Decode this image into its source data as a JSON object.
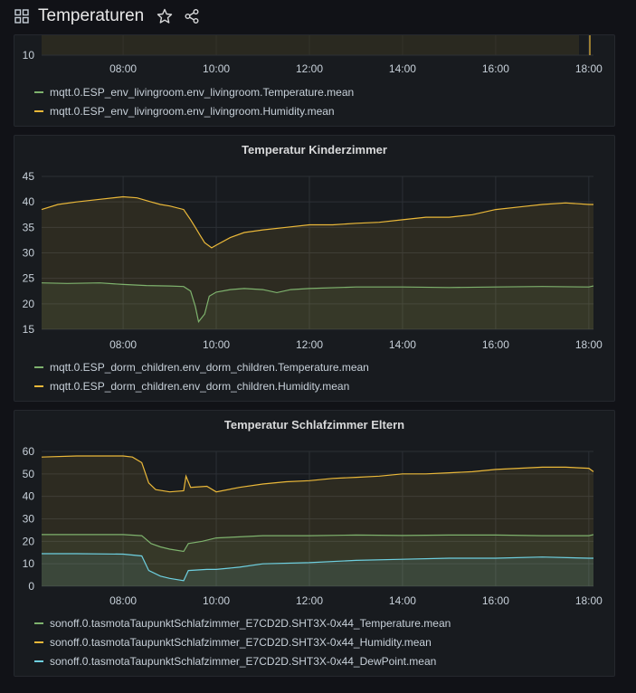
{
  "dashboard": {
    "title": "Temperaturen"
  },
  "colors": {
    "temperature": "#7eb26d",
    "humidity": "#eab839",
    "dewpoint": "#6ed0e0",
    "grid": "#2c3036"
  },
  "x_ticks": [
    "08:00",
    "10:00",
    "12:00",
    "14:00",
    "16:00",
    "18:00"
  ],
  "panels": [
    {
      "title": "",
      "legend": [
        {
          "label": "mqtt.0.ESP_env_livingroom.env_livingroom.Temperature.mean",
          "color_key": "temperature"
        },
        {
          "label": "mqtt.0.ESP_env_livingroom.env_livingroom.Humidity.mean",
          "color_key": "humidity"
        }
      ]
    },
    {
      "title": "Temperatur Kinderzimmer",
      "legend": [
        {
          "label": "mqtt.0.ESP_dorm_children.env_dorm_children.Temperature.mean",
          "color_key": "temperature"
        },
        {
          "label": "mqtt.0.ESP_dorm_children.env_dorm_children.Humidity.mean",
          "color_key": "humidity"
        }
      ]
    },
    {
      "title": "Temperatur Schlafzimmer Eltern",
      "legend": [
        {
          "label": "sonoff.0.tasmotaTaupunktSchlafzimmer_E7CD2D.SHT3X-0x44_Temperature.mean",
          "color_key": "temperature"
        },
        {
          "label": "sonoff.0.tasmotaTaupunktSchlafzimmer_E7CD2D.SHT3X-0x44_Humidity.mean",
          "color_key": "humidity"
        },
        {
          "label": "sonoff.0.tasmotaTaupunktSchlafzimmer_E7CD2D.SHT3X-0x44_DewPoint.mean",
          "color_key": "dewpoint"
        }
      ]
    }
  ],
  "chart_data": [
    {
      "type": "line",
      "title": "",
      "x_unit": "hour of day",
      "xlim": [
        6.25,
        18.1
      ],
      "x_ticks": [
        "08:00",
        "10:00",
        "12:00",
        "14:00",
        "16:00",
        "18:00"
      ],
      "y_ticks": [
        10
      ],
      "series": [
        {
          "name": "mqtt.0.ESP_env_livingroom.env_livingroom.Temperature.mean",
          "x": [],
          "values": []
        },
        {
          "name": "mqtt.0.ESP_env_livingroom.env_livingroom.Humidity.mean",
          "x": [],
          "values": []
        }
      ]
    },
    {
      "type": "line",
      "title": "Temperatur Kinderzimmer",
      "x_unit": "hour of day",
      "xlim": [
        6.25,
        18.1
      ],
      "ylim": [
        15,
        45
      ],
      "y_ticks": [
        15,
        20,
        25,
        30,
        35,
        40,
        45
      ],
      "x_ticks": [
        "08:00",
        "10:00",
        "12:00",
        "14:00",
        "16:00",
        "18:00"
      ],
      "grid": true,
      "series": [
        {
          "name": "mqtt.0.ESP_dorm_children.env_dorm_children.Temperature.mean",
          "x": [
            6.25,
            6.8,
            7.5,
            8.0,
            8.5,
            9.0,
            9.3,
            9.45,
            9.55,
            9.62,
            9.75,
            9.85,
            10.0,
            10.3,
            10.6,
            11.0,
            11.3,
            11.6,
            12.0,
            13.0,
            14.0,
            15.0,
            16.0,
            17.0,
            18.0,
            18.1
          ],
          "values": [
            24.1,
            24.0,
            24.1,
            23.8,
            23.6,
            23.5,
            23.4,
            22.5,
            19.5,
            16.5,
            18.0,
            21.5,
            22.3,
            22.8,
            23.0,
            22.8,
            22.2,
            22.8,
            23.0,
            23.3,
            23.3,
            23.2,
            23.3,
            23.4,
            23.3,
            23.5
          ]
        },
        {
          "name": "mqtt.0.ESP_dorm_children.env_dorm_children.Humidity.mean",
          "x": [
            6.25,
            6.6,
            7.0,
            7.5,
            8.0,
            8.3,
            8.6,
            8.8,
            9.0,
            9.3,
            9.45,
            9.55,
            9.65,
            9.75,
            9.9,
            10.0,
            10.3,
            10.6,
            11.0,
            11.5,
            12.0,
            12.5,
            13.0,
            13.5,
            14.0,
            14.5,
            15.0,
            15.5,
            16.0,
            16.5,
            17.0,
            17.5,
            18.0,
            18.1
          ],
          "values": [
            38.5,
            39.5,
            40.0,
            40.5,
            41.0,
            40.8,
            40.0,
            39.5,
            39.2,
            38.5,
            36.5,
            35.0,
            33.5,
            32.0,
            31.0,
            31.5,
            33.0,
            34.0,
            34.5,
            35.0,
            35.5,
            35.5,
            35.8,
            36.0,
            36.5,
            37.0,
            37.0,
            37.5,
            38.5,
            39.0,
            39.5,
            39.8,
            39.5,
            39.5
          ]
        }
      ]
    },
    {
      "type": "line",
      "title": "Temperatur Schlafzimmer Eltern",
      "x_unit": "hour of day",
      "xlim": [
        6.25,
        18.1
      ],
      "ylim": [
        0,
        60
      ],
      "y_ticks": [
        0,
        10,
        20,
        30,
        40,
        50,
        60
      ],
      "x_ticks": [
        "08:00",
        "10:00",
        "12:00",
        "14:00",
        "16:00",
        "18:00"
      ],
      "grid": true,
      "series": [
        {
          "name": "sonoff.0.tasmotaTaupunktSchlafzimmer_E7CD2D.SHT3X-0x44_Temperature.mean",
          "x": [
            6.25,
            7.0,
            8.0,
            8.4,
            8.6,
            8.8,
            9.0,
            9.3,
            9.4,
            9.7,
            10.0,
            10.5,
            11.0,
            12.0,
            13.0,
            14.0,
            15.0,
            16.0,
            17.0,
            18.0,
            18.1
          ],
          "values": [
            23.0,
            23.0,
            23.0,
            22.5,
            19.0,
            17.5,
            16.5,
            15.5,
            19.0,
            20.0,
            21.5,
            22.0,
            22.5,
            22.5,
            22.8,
            22.6,
            22.8,
            22.8,
            22.5,
            22.5,
            23.0
          ]
        },
        {
          "name": "sonoff.0.tasmotaTaupunktSchlafzimmer_E7CD2D.SHT3X-0x44_Humidity.mean",
          "x": [
            6.25,
            7.0,
            8.0,
            8.2,
            8.4,
            8.55,
            8.7,
            9.0,
            9.3,
            9.35,
            9.45,
            9.8,
            10.0,
            10.5,
            11.0,
            11.5,
            12.0,
            12.5,
            13.0,
            13.5,
            14.0,
            14.5,
            15.0,
            15.5,
            16.0,
            16.5,
            17.0,
            17.5,
            18.0,
            18.1
          ],
          "values": [
            57.5,
            58.0,
            58.0,
            57.5,
            55.0,
            46.0,
            43.0,
            42.0,
            42.5,
            49.0,
            44.0,
            44.5,
            42.0,
            44.0,
            45.5,
            46.5,
            47.0,
            48.0,
            48.5,
            49.0,
            50.0,
            50.0,
            50.5,
            51.0,
            52.0,
            52.5,
            53.0,
            53.0,
            52.5,
            51.0
          ]
        },
        {
          "name": "sonoff.0.tasmotaTaupunktSchlafzimmer_E7CD2D.SHT3X-0x44_DewPoint.mean",
          "x": [
            6.25,
            7.0,
            8.0,
            8.4,
            8.55,
            8.8,
            9.0,
            9.3,
            9.4,
            9.8,
            10.0,
            10.5,
            11.0,
            12.0,
            13.0,
            14.0,
            15.0,
            16.0,
            17.0,
            18.0,
            18.1
          ],
          "values": [
            14.5,
            14.5,
            14.3,
            13.5,
            7.0,
            4.5,
            3.5,
            2.5,
            7.0,
            7.5,
            7.5,
            8.5,
            10.0,
            10.5,
            11.5,
            12.0,
            12.5,
            12.5,
            13.0,
            12.5,
            12.5
          ]
        }
      ]
    }
  ]
}
